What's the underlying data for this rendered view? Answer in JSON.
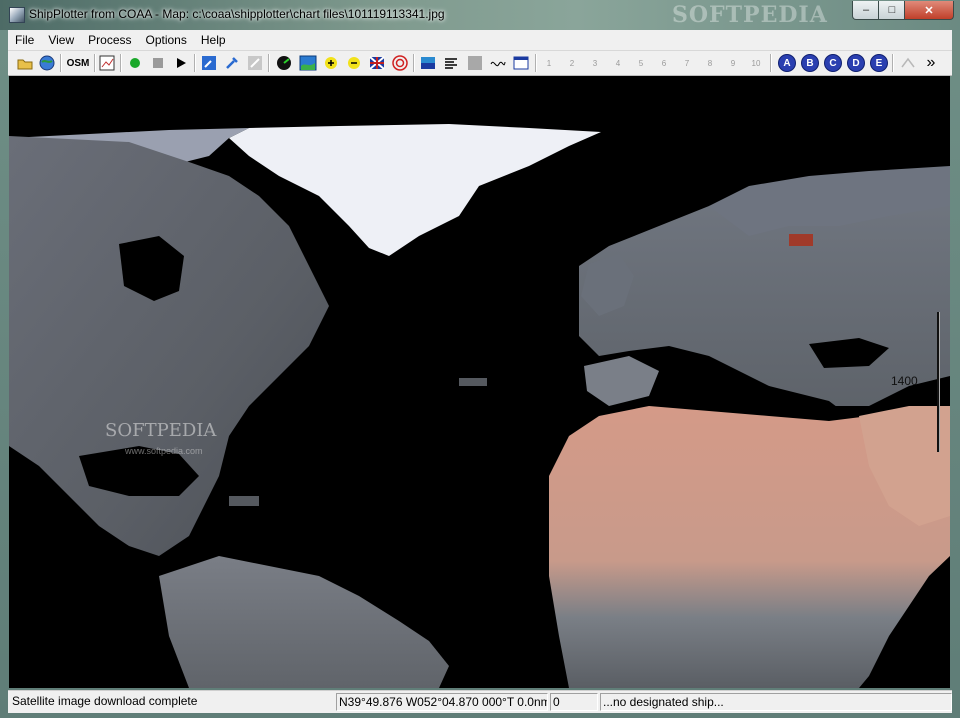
{
  "window": {
    "title": "ShipPlotter from COAA - Map: c:\\coaa\\shipplotter\\chart files\\101119113341.jpg",
    "watermark": "SOFTPEDIA",
    "buttons": {
      "minimize": "–",
      "maximize": "□",
      "close": "✕"
    }
  },
  "menu": [
    "File",
    "View",
    "Process",
    "Options",
    "Help"
  ],
  "toolbar": {
    "osm_label": "OSM",
    "number_buttons": [
      "1",
      "2",
      "3",
      "4",
      "5",
      "6",
      "7",
      "8",
      "9",
      "10"
    ],
    "letter_buttons": [
      "A",
      "B",
      "C",
      "D",
      "E"
    ],
    "more": "»"
  },
  "map": {
    "scale_label": "1400",
    "softpedia_watermark": "SOFTPEDIA",
    "softpedia_url": "www.softpedia.com"
  },
  "status": {
    "message": "Satellite image download complete",
    "position": "N39°49.876 W052°04.870 000°T 0.0nm",
    "count": "0",
    "ship": "...no designated ship..."
  }
}
